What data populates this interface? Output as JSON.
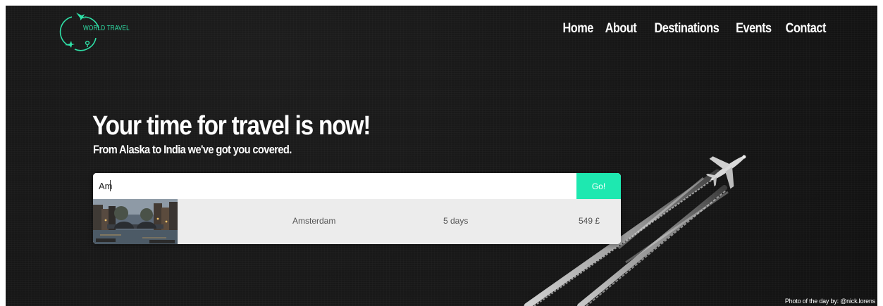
{
  "logo": {
    "text": "WORLD TRAVEL",
    "accent_color": "#2fe0a7"
  },
  "nav": {
    "items": [
      {
        "label": "Home"
      },
      {
        "label": "About"
      },
      {
        "label": "Destinations"
      },
      {
        "label": "Events"
      },
      {
        "label": "Contact"
      }
    ]
  },
  "hero": {
    "title": "Your time for travel is now!",
    "subtitle": "From Alaska to India we've got you covered."
  },
  "search": {
    "value": "Am",
    "placeholder": "",
    "button_label": "Go!",
    "button_color": "#1ee8b0"
  },
  "results": [
    {
      "thumbnail_icon": "amsterdam-canal-photo",
      "city": "Amsterdam",
      "duration": "5 days",
      "price": "549 £"
    }
  ],
  "footer": {
    "credit": "Photo of the day by: @nick.lorens"
  },
  "background_color": "#161616"
}
